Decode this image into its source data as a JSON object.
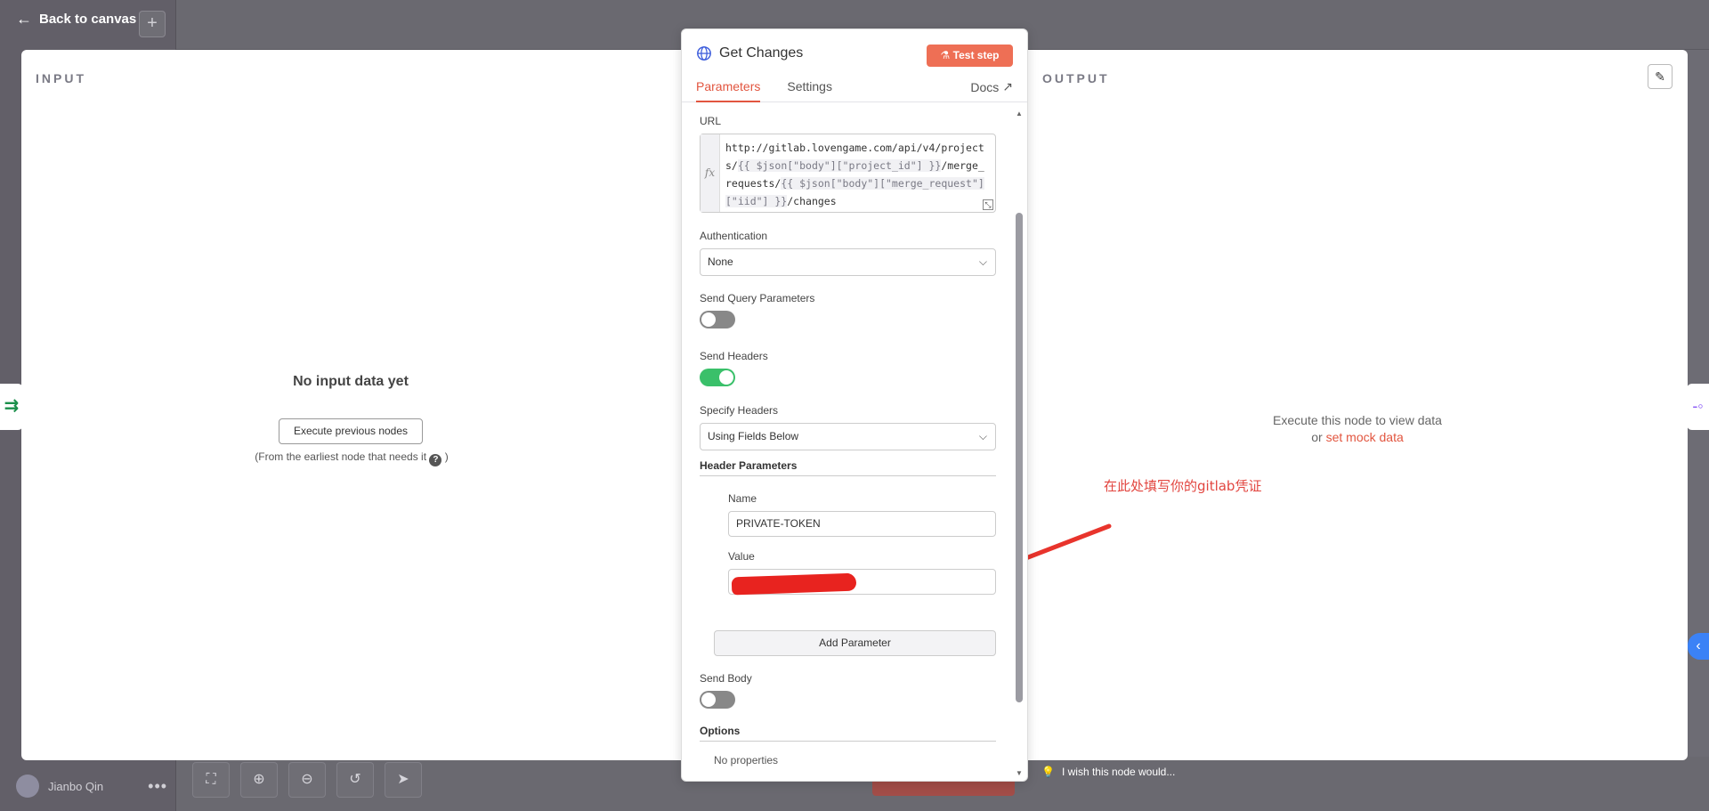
{
  "app": {
    "back_label": "Back to canvas",
    "user_name": "Jianbo Qin"
  },
  "input_pane": {
    "title": "INPUT",
    "empty_title": "No input data yet",
    "exec_button": "Execute previous nodes",
    "hint_prefix": "(From the earliest node that needs it",
    "hint_suffix": ")"
  },
  "output_pane": {
    "title": "OUTPUT",
    "exec_text": "Execute this node to view data",
    "or_text": "or",
    "mock_link": "set mock data"
  },
  "node": {
    "title": "Get Changes",
    "test_button": "Test step",
    "tabs": [
      {
        "label": "Parameters",
        "active": true
      },
      {
        "label": "Settings",
        "active": false
      }
    ],
    "docs_label": "Docs",
    "url": {
      "label": "URL",
      "part1": "http://gitlab.lovengame.com/api/v4/projects/",
      "expr1": "{{ $json[\"body\"][\"project_id\"] }}",
      "part2": "/merge_requests/",
      "expr2": "{{ $json[\"body\"][\"merge_request\"][\"iid\"] }}",
      "part3": "/changes"
    },
    "authentication": {
      "label": "Authentication",
      "value": "None"
    },
    "send_query": {
      "label": "Send Query Parameters",
      "on": false
    },
    "send_headers": {
      "label": "Send Headers",
      "on": true
    },
    "specify_headers": {
      "label": "Specify Headers",
      "value": "Using Fields Below"
    },
    "header_params": {
      "title": "Header Parameters",
      "name_label": "Name",
      "name_value": "PRIVATE-TOKEN",
      "value_label": "Value"
    },
    "add_param": "Add Parameter",
    "send_body": {
      "label": "Send Body",
      "on": false
    },
    "options": {
      "title": "Options",
      "empty": "No properties"
    }
  },
  "annotation": "在此处填写你的gitlab凭证",
  "wish": "I wish this node would...",
  "colors": {
    "accent": "#e2553f",
    "toggle_on": "#3ac06a",
    "test_button": "#ee6f55",
    "annotation": "#e2453f"
  }
}
